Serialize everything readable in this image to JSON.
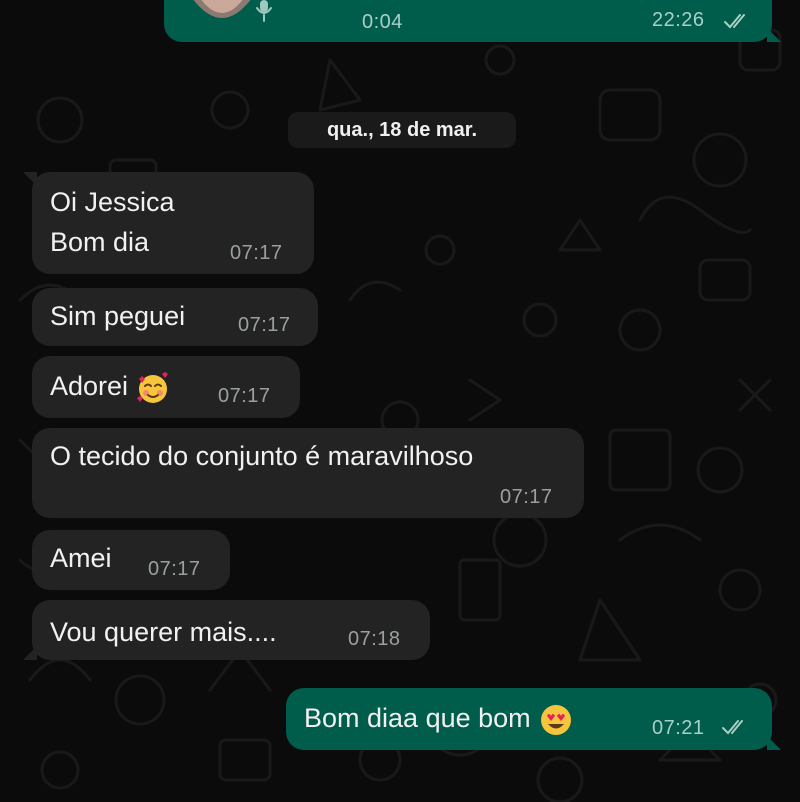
{
  "audio_message": {
    "duration": "0:04",
    "time": "22:26",
    "status_icon": "double-check-icon"
  },
  "date_separator": "qua., 18 de mar.",
  "messages": [
    {
      "line1": "Oi Jessica",
      "line2": "Bom dia",
      "time": "07:17"
    },
    {
      "text": "Sim peguei",
      "time": "07:17"
    },
    {
      "text": "Adorei",
      "emoji": "smiling-face-with-hearts",
      "time": "07:17"
    },
    {
      "text": "O tecido do conjunto é maravilhoso",
      "time": "07:17"
    },
    {
      "text": "Amei",
      "time": "07:17"
    },
    {
      "text": "Vou querer mais....",
      "time": "07:18"
    }
  ],
  "reply": {
    "text": "Bom diaa que bom",
    "emoji": "heart-eyes",
    "time": "07:21",
    "status_icon": "double-check-icon"
  },
  "colors": {
    "incoming_bubble": "#232323",
    "outgoing_bubble": "#005c4b",
    "background": "#0b0b0b"
  }
}
